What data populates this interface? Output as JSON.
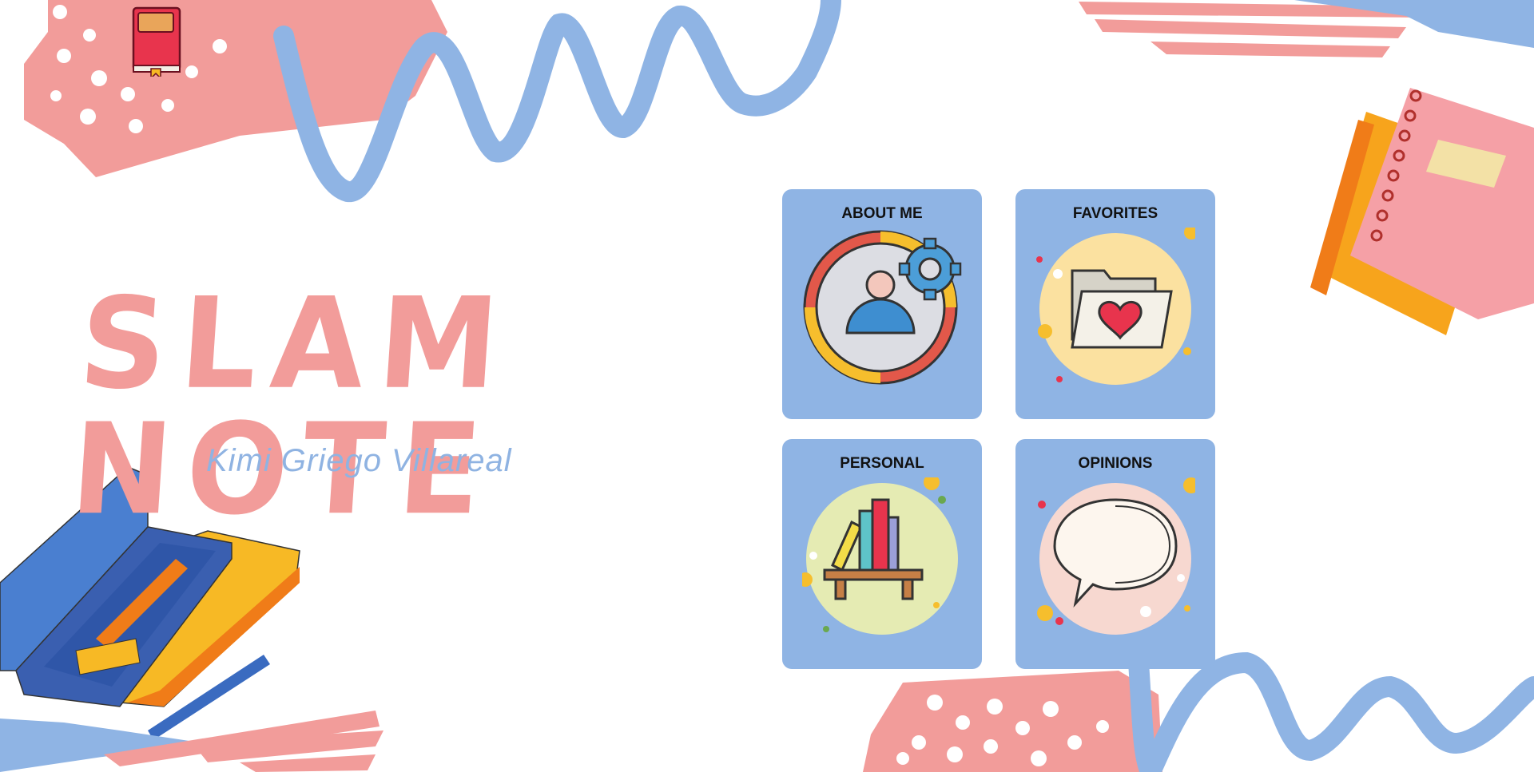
{
  "header": {
    "title": "SLAM NOTE",
    "subtitle": "Kimi Griego Villareal"
  },
  "cards": [
    {
      "label": "ABOUT ME",
      "icon": "profile-settings-icon"
    },
    {
      "label": "FAVORITES",
      "icon": "favorite-folder-icon"
    },
    {
      "label": "PERSONAL",
      "icon": "bookshelf-icon"
    },
    {
      "label": "OPINIONS",
      "icon": "speech-bubble-icon"
    }
  ],
  "colors": {
    "pink": "#f29c9a",
    "blue": "#8fb4e4",
    "yellow": "#f7b925",
    "red": "#e8344d"
  }
}
